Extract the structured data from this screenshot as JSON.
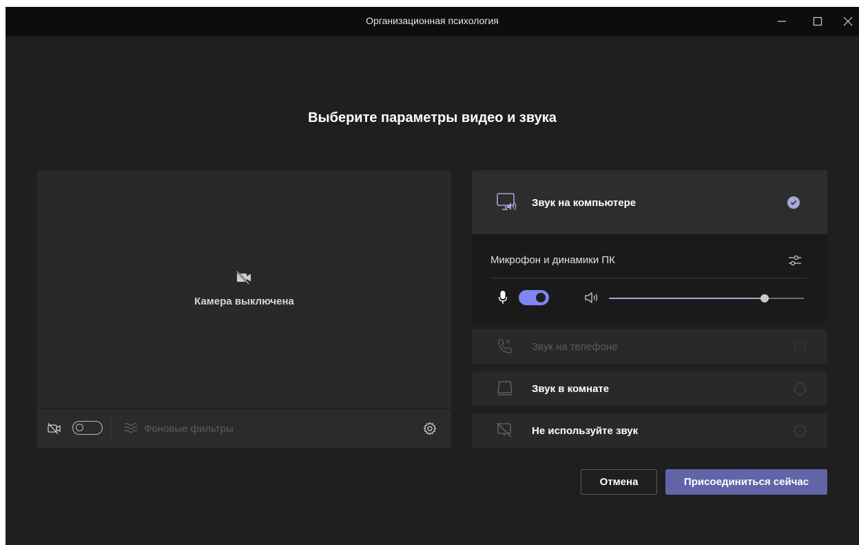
{
  "window": {
    "title": "Организационная психология"
  },
  "heading": "Выберите параметры видео и звука",
  "video": {
    "camera_off_text": "Камера выключена",
    "camera_toggle_on": false,
    "background_filters_label": "Фоновые фильтры"
  },
  "audio": {
    "options": [
      {
        "label": "Звук на компьютере",
        "icon": "computer-audio-icon",
        "selected": true,
        "disabled": false
      },
      {
        "label": "Звук на телефоне",
        "icon": "phone-audio-icon",
        "selected": false,
        "disabled": true
      },
      {
        "label": "Звук в комнате",
        "icon": "room-audio-icon",
        "selected": false,
        "disabled": false
      },
      {
        "label": "Не используйте звук",
        "icon": "no-audio-icon",
        "selected": false,
        "disabled": false
      }
    ],
    "device_name": "Микрофон и динамики ПК",
    "mic_on": true,
    "volume_percent": 80
  },
  "actions": {
    "cancel_label": "Отмена",
    "join_label": "Присоединиться сейчас"
  },
  "colors": {
    "accent": "#7f85f5",
    "join_button": "#6264a7",
    "background": "#1f1f1f",
    "titlebar": "#0d0d0d"
  }
}
